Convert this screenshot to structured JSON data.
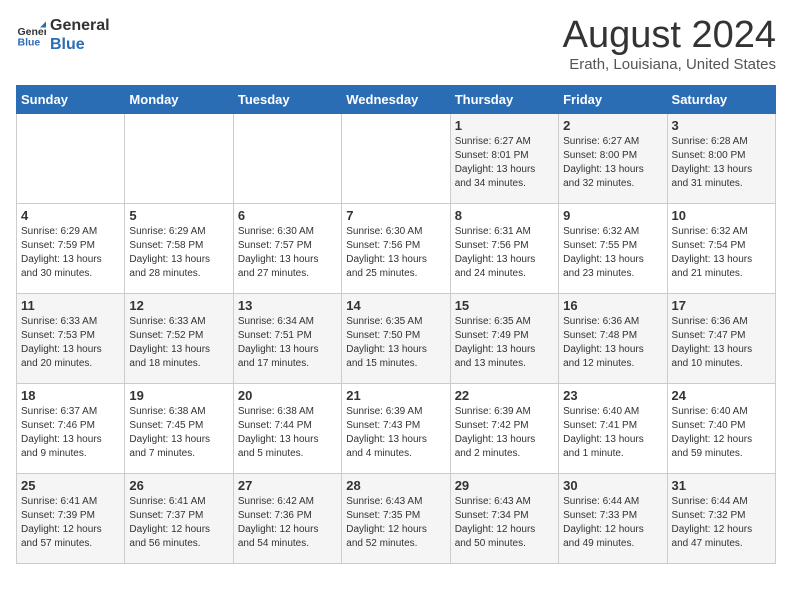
{
  "logo": {
    "line1": "General",
    "line2": "Blue"
  },
  "title": "August 2024",
  "subtitle": "Erath, Louisiana, United States",
  "weekdays": [
    "Sunday",
    "Monday",
    "Tuesday",
    "Wednesday",
    "Thursday",
    "Friday",
    "Saturday"
  ],
  "weeks": [
    [
      {
        "day": "",
        "sunrise": "",
        "sunset": "",
        "daylight": ""
      },
      {
        "day": "",
        "sunrise": "",
        "sunset": "",
        "daylight": ""
      },
      {
        "day": "",
        "sunrise": "",
        "sunset": "",
        "daylight": ""
      },
      {
        "day": "",
        "sunrise": "",
        "sunset": "",
        "daylight": ""
      },
      {
        "day": "1",
        "sunrise": "Sunrise: 6:27 AM",
        "sunset": "Sunset: 8:01 PM",
        "daylight": "Daylight: 13 hours and 34 minutes."
      },
      {
        "day": "2",
        "sunrise": "Sunrise: 6:27 AM",
        "sunset": "Sunset: 8:00 PM",
        "daylight": "Daylight: 13 hours and 32 minutes."
      },
      {
        "day": "3",
        "sunrise": "Sunrise: 6:28 AM",
        "sunset": "Sunset: 8:00 PM",
        "daylight": "Daylight: 13 hours and 31 minutes."
      }
    ],
    [
      {
        "day": "4",
        "sunrise": "Sunrise: 6:29 AM",
        "sunset": "Sunset: 7:59 PM",
        "daylight": "Daylight: 13 hours and 30 minutes."
      },
      {
        "day": "5",
        "sunrise": "Sunrise: 6:29 AM",
        "sunset": "Sunset: 7:58 PM",
        "daylight": "Daylight: 13 hours and 28 minutes."
      },
      {
        "day": "6",
        "sunrise": "Sunrise: 6:30 AM",
        "sunset": "Sunset: 7:57 PM",
        "daylight": "Daylight: 13 hours and 27 minutes."
      },
      {
        "day": "7",
        "sunrise": "Sunrise: 6:30 AM",
        "sunset": "Sunset: 7:56 PM",
        "daylight": "Daylight: 13 hours and 25 minutes."
      },
      {
        "day": "8",
        "sunrise": "Sunrise: 6:31 AM",
        "sunset": "Sunset: 7:56 PM",
        "daylight": "Daylight: 13 hours and 24 minutes."
      },
      {
        "day": "9",
        "sunrise": "Sunrise: 6:32 AM",
        "sunset": "Sunset: 7:55 PM",
        "daylight": "Daylight: 13 hours and 23 minutes."
      },
      {
        "day": "10",
        "sunrise": "Sunrise: 6:32 AM",
        "sunset": "Sunset: 7:54 PM",
        "daylight": "Daylight: 13 hours and 21 minutes."
      }
    ],
    [
      {
        "day": "11",
        "sunrise": "Sunrise: 6:33 AM",
        "sunset": "Sunset: 7:53 PM",
        "daylight": "Daylight: 13 hours and 20 minutes."
      },
      {
        "day": "12",
        "sunrise": "Sunrise: 6:33 AM",
        "sunset": "Sunset: 7:52 PM",
        "daylight": "Daylight: 13 hours and 18 minutes."
      },
      {
        "day": "13",
        "sunrise": "Sunrise: 6:34 AM",
        "sunset": "Sunset: 7:51 PM",
        "daylight": "Daylight: 13 hours and 17 minutes."
      },
      {
        "day": "14",
        "sunrise": "Sunrise: 6:35 AM",
        "sunset": "Sunset: 7:50 PM",
        "daylight": "Daylight: 13 hours and 15 minutes."
      },
      {
        "day": "15",
        "sunrise": "Sunrise: 6:35 AM",
        "sunset": "Sunset: 7:49 PM",
        "daylight": "Daylight: 13 hours and 13 minutes."
      },
      {
        "day": "16",
        "sunrise": "Sunrise: 6:36 AM",
        "sunset": "Sunset: 7:48 PM",
        "daylight": "Daylight: 13 hours and 12 minutes."
      },
      {
        "day": "17",
        "sunrise": "Sunrise: 6:36 AM",
        "sunset": "Sunset: 7:47 PM",
        "daylight": "Daylight: 13 hours and 10 minutes."
      }
    ],
    [
      {
        "day": "18",
        "sunrise": "Sunrise: 6:37 AM",
        "sunset": "Sunset: 7:46 PM",
        "daylight": "Daylight: 13 hours and 9 minutes."
      },
      {
        "day": "19",
        "sunrise": "Sunrise: 6:38 AM",
        "sunset": "Sunset: 7:45 PM",
        "daylight": "Daylight: 13 hours and 7 minutes."
      },
      {
        "day": "20",
        "sunrise": "Sunrise: 6:38 AM",
        "sunset": "Sunset: 7:44 PM",
        "daylight": "Daylight: 13 hours and 5 minutes."
      },
      {
        "day": "21",
        "sunrise": "Sunrise: 6:39 AM",
        "sunset": "Sunset: 7:43 PM",
        "daylight": "Daylight: 13 hours and 4 minutes."
      },
      {
        "day": "22",
        "sunrise": "Sunrise: 6:39 AM",
        "sunset": "Sunset: 7:42 PM",
        "daylight": "Daylight: 13 hours and 2 minutes."
      },
      {
        "day": "23",
        "sunrise": "Sunrise: 6:40 AM",
        "sunset": "Sunset: 7:41 PM",
        "daylight": "Daylight: 13 hours and 1 minute."
      },
      {
        "day": "24",
        "sunrise": "Sunrise: 6:40 AM",
        "sunset": "Sunset: 7:40 PM",
        "daylight": "Daylight: 12 hours and 59 minutes."
      }
    ],
    [
      {
        "day": "25",
        "sunrise": "Sunrise: 6:41 AM",
        "sunset": "Sunset: 7:39 PM",
        "daylight": "Daylight: 12 hours and 57 minutes."
      },
      {
        "day": "26",
        "sunrise": "Sunrise: 6:41 AM",
        "sunset": "Sunset: 7:37 PM",
        "daylight": "Daylight: 12 hours and 56 minutes."
      },
      {
        "day": "27",
        "sunrise": "Sunrise: 6:42 AM",
        "sunset": "Sunset: 7:36 PM",
        "daylight": "Daylight: 12 hours and 54 minutes."
      },
      {
        "day": "28",
        "sunrise": "Sunrise: 6:43 AM",
        "sunset": "Sunset: 7:35 PM",
        "daylight": "Daylight: 12 hours and 52 minutes."
      },
      {
        "day": "29",
        "sunrise": "Sunrise: 6:43 AM",
        "sunset": "Sunset: 7:34 PM",
        "daylight": "Daylight: 12 hours and 50 minutes."
      },
      {
        "day": "30",
        "sunrise": "Sunrise: 6:44 AM",
        "sunset": "Sunset: 7:33 PM",
        "daylight": "Daylight: 12 hours and 49 minutes."
      },
      {
        "day": "31",
        "sunrise": "Sunrise: 6:44 AM",
        "sunset": "Sunset: 7:32 PM",
        "daylight": "Daylight: 12 hours and 47 minutes."
      }
    ]
  ]
}
